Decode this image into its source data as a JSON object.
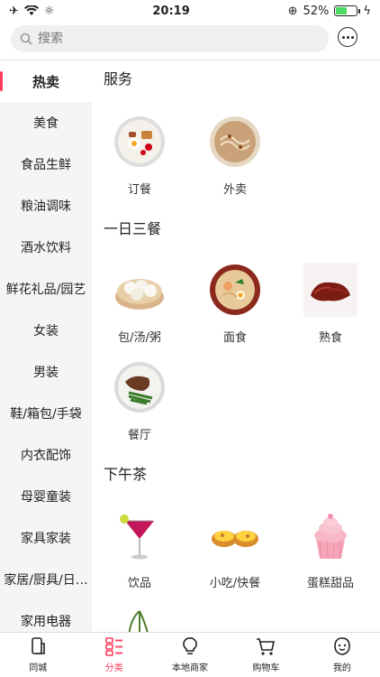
{
  "status": {
    "time": "20:19",
    "battery": "52%",
    "battery_level": 0.52
  },
  "search": {
    "placeholder": "搜索"
  },
  "sidebar": {
    "items": [
      {
        "label": "热卖",
        "active": true
      },
      {
        "label": "美食"
      },
      {
        "label": "食品生鲜"
      },
      {
        "label": "粮油调味"
      },
      {
        "label": "酒水饮料"
      },
      {
        "label": "鲜花礼品/园艺"
      },
      {
        "label": "女装"
      },
      {
        "label": "男装"
      },
      {
        "label": "鞋/箱包/手袋"
      },
      {
        "label": "内衣配饰"
      },
      {
        "label": "母婴童装"
      },
      {
        "label": "家具家装"
      },
      {
        "label": "家居/厨具/日…"
      },
      {
        "label": "家用电器"
      }
    ]
  },
  "sections": [
    {
      "title": "服务",
      "items": [
        {
          "label": "订餐",
          "icon": "breakfast-plate-icon"
        },
        {
          "label": "外卖",
          "icon": "noodle-bowl-icon"
        }
      ]
    },
    {
      "title": "一日三餐",
      "items": [
        {
          "label": "包/汤/粥",
          "icon": "dumplings-icon"
        },
        {
          "label": "面食",
          "icon": "ramen-icon"
        },
        {
          "label": "熟食",
          "icon": "cooked-meat-icon"
        },
        {
          "label": "餐厅",
          "icon": "steak-plate-icon"
        }
      ]
    },
    {
      "title": "下午茶",
      "items": [
        {
          "label": "饮品",
          "icon": "cocktail-icon"
        },
        {
          "label": "小吃/快餐",
          "icon": "egg-tart-icon"
        },
        {
          "label": "蛋糕甜品",
          "icon": "cupcake-icon"
        },
        {
          "label": "",
          "icon": "cherries-icon"
        }
      ]
    }
  ],
  "tabbar": {
    "tabs": [
      {
        "label": "同城",
        "icon": "phone-icon"
      },
      {
        "label": "分类",
        "icon": "category-list-icon",
        "active": true
      },
      {
        "label": "本地商家",
        "icon": "lightbulb-icon"
      },
      {
        "label": "购物车",
        "icon": "cart-icon"
      },
      {
        "label": "我的",
        "icon": "profile-icon"
      }
    ]
  },
  "colors": {
    "accent": "#ff3b5c",
    "sidebar_bg": "#f5f5f5",
    "battery": "#4cd964"
  }
}
